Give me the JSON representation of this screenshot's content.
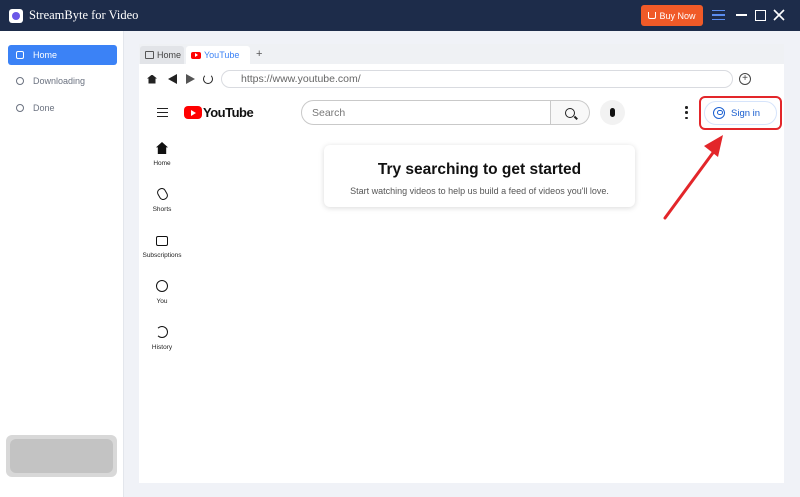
{
  "window": {
    "title": "StreamByte for Video",
    "buy_label": "Buy Now"
  },
  "sidebar": {
    "items": [
      {
        "label": "Home",
        "active": true
      },
      {
        "label": "Downloading",
        "active": false
      },
      {
        "label": "Done",
        "active": false
      }
    ]
  },
  "browser": {
    "tabs": [
      {
        "label": "Home"
      },
      {
        "label": "YouTube"
      }
    ],
    "new_tab_label": "+",
    "url": "https://www.youtube.com/"
  },
  "youtube": {
    "logo_text": "YouTube",
    "search_placeholder": "Search",
    "signin_label": "Sign in",
    "nav": [
      {
        "label": "Home",
        "icon": "home-icon"
      },
      {
        "label": "Shorts",
        "icon": "shorts-icon"
      },
      {
        "label": "Subscriptions",
        "icon": "subscriptions-icon"
      },
      {
        "label": "You",
        "icon": "you-icon"
      },
      {
        "label": "History",
        "icon": "history-icon"
      }
    ],
    "card": {
      "title": "Try searching to get started",
      "subtitle": "Start watching videos to help us build a feed of videos you'll love."
    }
  },
  "colors": {
    "titlebar": "#1d2c4a",
    "accent": "#3b82f6",
    "buy": "#f05a28",
    "annotation": "#e3262a",
    "youtube_red": "#ff0000"
  }
}
